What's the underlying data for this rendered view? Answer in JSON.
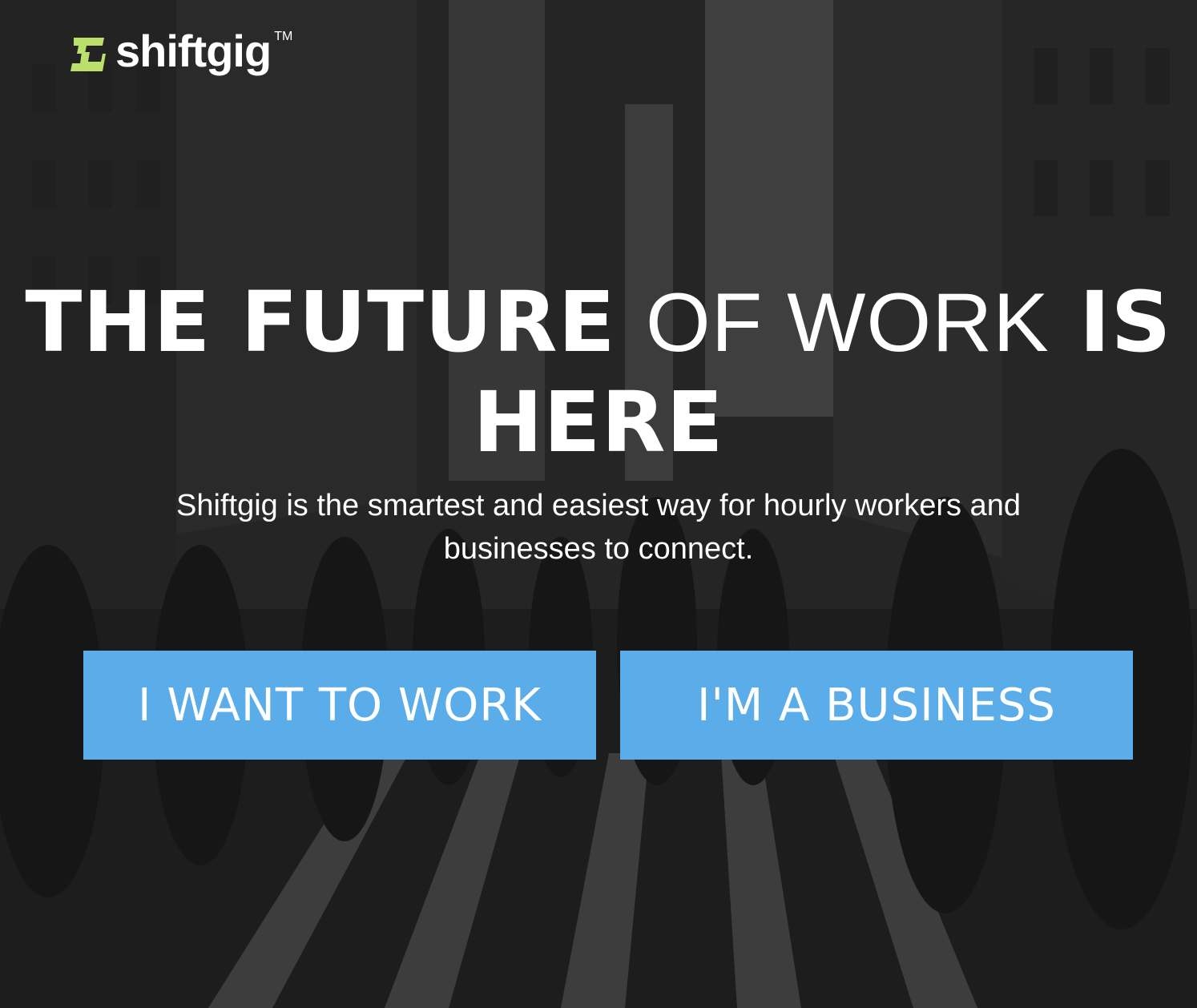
{
  "brand": {
    "name": "shiftgig",
    "trademark": "TM",
    "logo_icon": "shiftgig-logo-icon",
    "logo_color": "#b9e06a"
  },
  "hero": {
    "headline": {
      "part1": "THE FUTURE",
      "part2": "OF WORK",
      "part3": "IS",
      "part4": "HERE"
    },
    "subtitle": "Shiftgig is the smartest and easiest way for hourly workers and businesses to connect.",
    "background_image": "black-and-white city street crosswalk with pedestrians"
  },
  "actions": {
    "work_label": "I WANT TO WORK",
    "business_label": "I'M A BUSINESS",
    "button_color": "#5aade8"
  }
}
